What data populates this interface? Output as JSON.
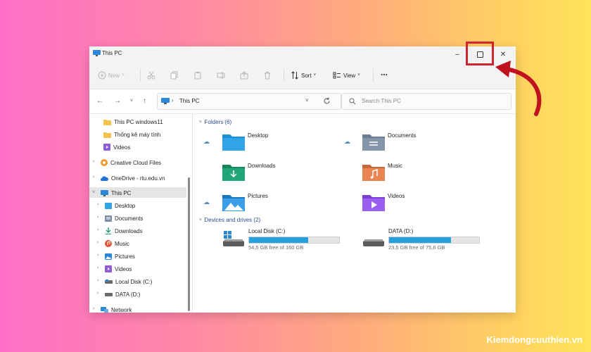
{
  "window": {
    "title": "This PC",
    "controls": {
      "minimize": "–",
      "maximize": "☐",
      "close": "✕"
    }
  },
  "toolbar": {
    "new_label": "New",
    "sort_label": "Sort",
    "view_label": "View",
    "more_label": "..."
  },
  "address": {
    "path": "This PC",
    "search_placeholder": "Search This PC"
  },
  "sidebar": {
    "items": [
      {
        "label": "This PC windows11",
        "icon": "folder-icon"
      },
      {
        "label": "Thống kê máy tính",
        "icon": "folder-icon"
      },
      {
        "label": "Videos",
        "icon": "videos-icon"
      },
      {
        "label": "Creative Cloud Files",
        "icon": "creative-cloud-icon"
      },
      {
        "label": "OneDrive - rtu.edu.vn",
        "icon": "onedrive-icon"
      },
      {
        "label": "This PC",
        "icon": "pc-icon"
      },
      {
        "label": "Desktop",
        "icon": "desktop-icon"
      },
      {
        "label": "Documents",
        "icon": "documents-icon"
      },
      {
        "label": "Downloads",
        "icon": "downloads-icon"
      },
      {
        "label": "Music",
        "icon": "music-icon"
      },
      {
        "label": "Pictures",
        "icon": "pictures-icon"
      },
      {
        "label": "Videos",
        "icon": "videos-icon"
      },
      {
        "label": "Local Disk (C:)",
        "icon": "drive-icon"
      },
      {
        "label": "DATA (D:)",
        "icon": "drive-icon"
      },
      {
        "label": "Network",
        "icon": "network-icon"
      }
    ]
  },
  "content": {
    "folders_title": "Folders (6)",
    "folders": [
      {
        "label": "Desktop"
      },
      {
        "label": "Documents"
      },
      {
        "label": "Downloads"
      },
      {
        "label": "Music"
      },
      {
        "label": "Pictures"
      },
      {
        "label": "Videos"
      }
    ],
    "drives_title": "Devices and drives (2)",
    "drives": [
      {
        "label": "Local Disk (C:)",
        "free": "54,5 GB free of 160 GB",
        "used_fraction": 0.66
      },
      {
        "label": "DATA (D:)",
        "free": "23,5 GB free of 75,6 GB",
        "used_fraction": 0.69
      }
    ]
  },
  "watermark": "Kiemdongcuuthien.vn",
  "colors": {
    "accent": "#26a0da",
    "highlight": "#d1242f",
    "arrow": "#c0121e"
  }
}
